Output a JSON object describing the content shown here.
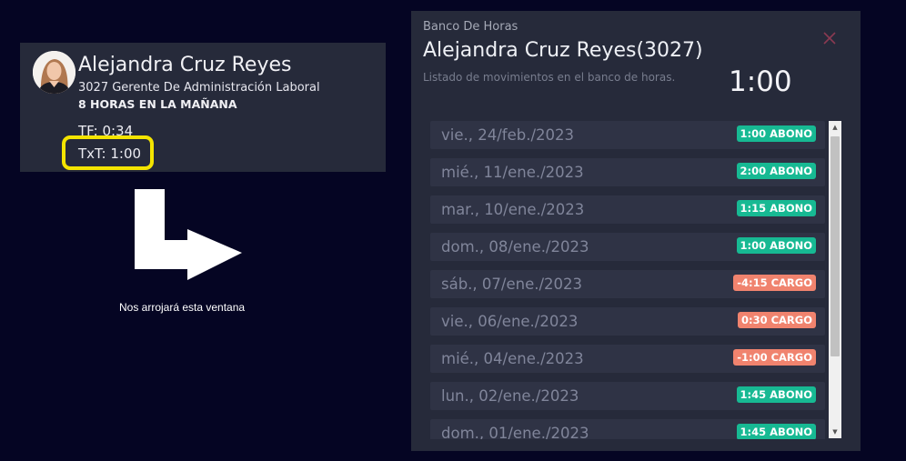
{
  "employee_card": {
    "name": "Alejandra Cruz Reyes",
    "role": "3027 Gerente De Administración Laboral",
    "shift": "8 HORAS EN LA MAÑANA",
    "tf": "TF: 0:34",
    "txt": "TxT: 1:00"
  },
  "caption": "Nos arrojará esta ventana",
  "modal": {
    "heading": "Banco De Horas",
    "title": "Alejandra Cruz Reyes(3027)",
    "subtitle": "Listado de movimientos en el banco de horas.",
    "total": "1:00",
    "rows": [
      {
        "date": "vie., 24/feb./2023",
        "badge": "1:00 ABONO",
        "type": "abono"
      },
      {
        "date": "mié., 11/ene./2023",
        "badge": "2:00 ABONO",
        "type": "abono"
      },
      {
        "date": "mar., 10/ene./2023",
        "badge": "1:15 ABONO",
        "type": "abono"
      },
      {
        "date": "dom., 08/ene./2023",
        "badge": "1:00 ABONO",
        "type": "abono"
      },
      {
        "date": "sáb., 07/ene./2023",
        "badge": "-4:15 CARGO",
        "type": "cargo"
      },
      {
        "date": "vie., 06/ene./2023",
        "badge": "0:30 CARGO",
        "type": "cargo"
      },
      {
        "date": "mié., 04/ene./2023",
        "badge": "-1:00 CARGO",
        "type": "cargo"
      },
      {
        "date": "lun., 02/ene./2023",
        "badge": "1:45 ABONO",
        "type": "abono"
      },
      {
        "date": "dom., 01/ene./2023",
        "badge": "1:45 ABONO",
        "type": "abono"
      }
    ]
  },
  "colors": {
    "background": "#050523",
    "panel": "#262a3a",
    "row": "#2f3345",
    "abono": "#17b993",
    "cargo": "#f0836e",
    "highlight": "#f4e400",
    "close": "#8a3a52"
  },
  "icons": {
    "close": "close-icon",
    "arrow": "arrow-down-right-icon",
    "avatar": "avatar-photo"
  }
}
